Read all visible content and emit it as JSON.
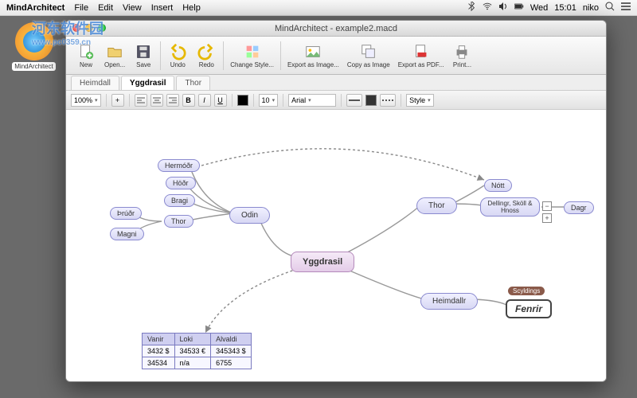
{
  "menubar": {
    "app": "MindArchitect",
    "items": [
      "File",
      "Edit",
      "View",
      "Insert",
      "Help"
    ],
    "right": {
      "day": "Wed",
      "time": "15:01",
      "user": "niko"
    }
  },
  "watermark": {
    "main": "河东软件园",
    "sub": "www.pc0359.cn"
  },
  "dock": {
    "label": "MindArchitect"
  },
  "window": {
    "title": "MindArchitect - example2.macd",
    "toolbar": [
      {
        "id": "new",
        "label": "New"
      },
      {
        "id": "open",
        "label": "Open..."
      },
      {
        "id": "save",
        "label": "Save"
      },
      {
        "id": "undo",
        "label": "Undo"
      },
      {
        "id": "redo",
        "label": "Redo"
      },
      {
        "id": "change-style",
        "label": "Change Style..."
      },
      {
        "id": "export-image",
        "label": "Export as Image..."
      },
      {
        "id": "copy-image",
        "label": "Copy as Image"
      },
      {
        "id": "export-pdf",
        "label": "Export as PDF..."
      },
      {
        "id": "print",
        "label": "Print..."
      }
    ],
    "tabs": [
      "Heimdall",
      "Yggdrasil",
      "Thor"
    ],
    "active_tab": 1,
    "format": {
      "zoom": "100%",
      "font_size": "10",
      "font_family": "Arial",
      "style_label": "Style"
    }
  },
  "mindmap": {
    "root": "Yggdrasil",
    "branches": {
      "odin": {
        "label": "Odin",
        "children": [
          "Hermóðr",
          "Höðr",
          "Bragi",
          "Thor"
        ]
      },
      "odin_left": {
        "thrudr": "Þrúðr",
        "magni": "Magni",
        "thor": "Thor"
      },
      "thor_r": {
        "label": "Thor",
        "nott": "Nótt",
        "dellingr": "Dellingr, Sköll & Hnoss",
        "dagr": "Dagr"
      },
      "heimdallr": {
        "label": "Heimdallr",
        "fenrir": "Fenrir",
        "badge": "Scyldings"
      }
    }
  },
  "table": {
    "headers": [
      "Vanir",
      "Loki",
      "Alvaldi"
    ],
    "rows": [
      [
        "3432 $",
        "34533 €",
        "345343 $"
      ],
      [
        "34534",
        "n/a",
        "6755"
      ]
    ]
  }
}
